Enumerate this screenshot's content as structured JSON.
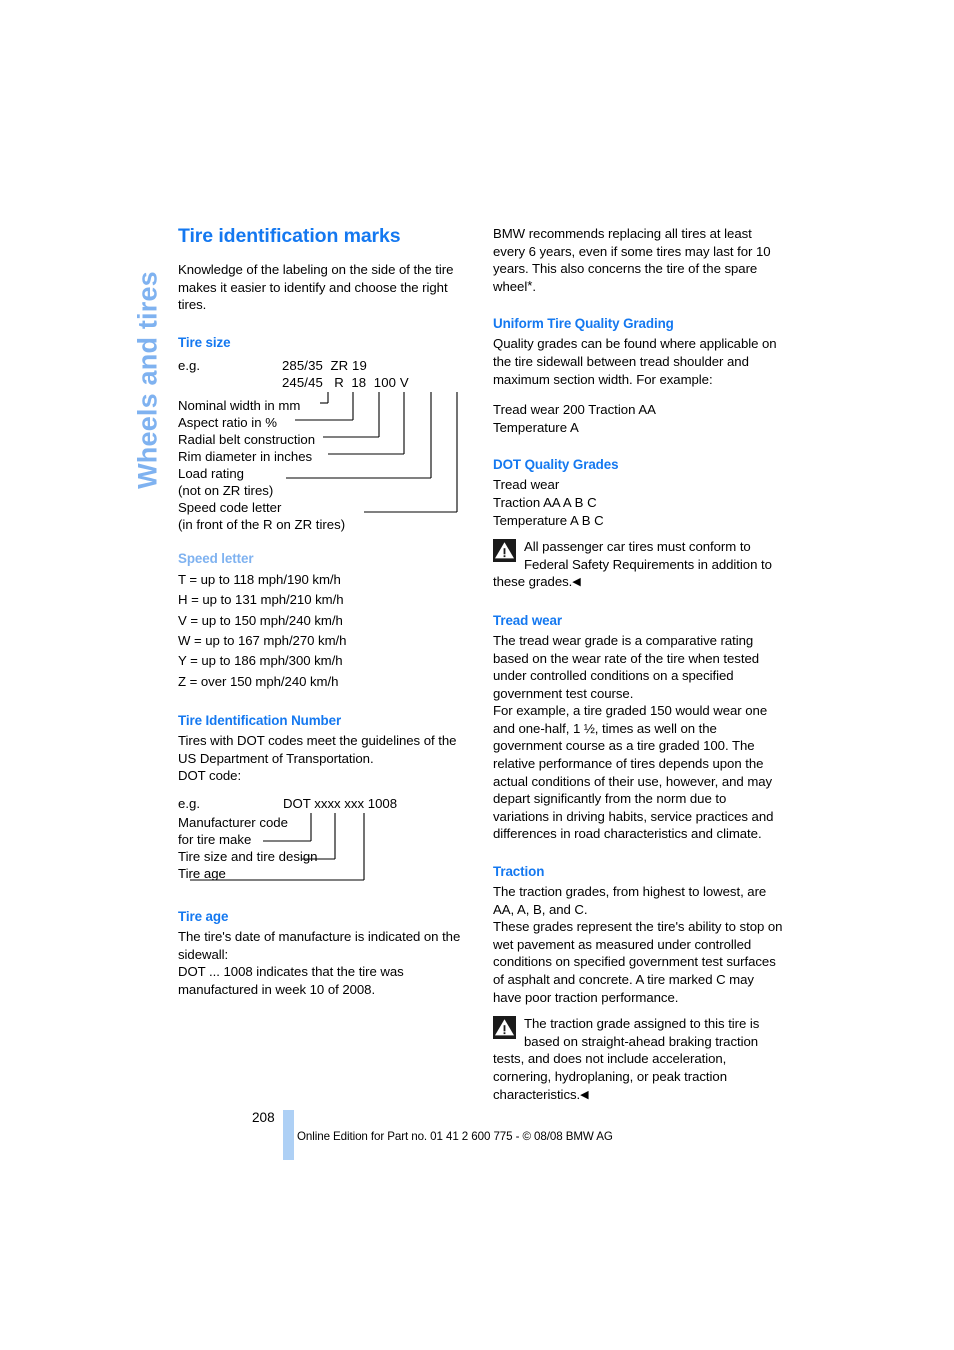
{
  "chapter": {
    "tab_label": "Wheels and tires"
  },
  "left_column": {
    "title": "Tire identification marks",
    "intro": "Knowledge of the labeling on the side of the tire makes it easier to identify and choose the right tires.",
    "tire_size": {
      "heading": "Tire size",
      "eg_label": "e.g.",
      "code_line_1": "285/35  ZR 19",
      "code_line_2": "245/45   R  18  100 V",
      "labels": [
        "Nominal width in mm",
        "Aspect ratio in %",
        "Radial belt construction",
        "Rim diameter in inches",
        "Load rating",
        "(not on ZR tires)",
        "Speed code letter",
        "(in front of the R on ZR tires)"
      ]
    },
    "speed_letter": {
      "heading": "Speed letter",
      "entries": [
        "T = up to 118 mph/190 km/h",
        "H = up to 131 mph/210 km/h",
        "V = up to 150 mph/240 km/h",
        "W = up to 167 mph/270 km/h",
        "Y = up to 186 mph/300 km/h",
        "Z = over 150 mph/240 km/h"
      ]
    },
    "tin": {
      "heading": "Tire Identification Number",
      "paragraph": "Tires with DOT codes meet the guidelines of the US Department of Transportation.",
      "dot_code_label": "DOT code:",
      "eg_label": "e.g.",
      "code_line": "DOT xxxx xxx 1008",
      "labels": [
        "Manufacturer code",
        "for tire make",
        "Tire size and tire design",
        "Tire age"
      ]
    },
    "tire_age": {
      "heading": "Tire age",
      "paragraph_1": "The tire's date of manufacture is indicated on the sidewall:",
      "paragraph_2": "DOT ... 1008 indicates that the tire was manufactured in week 10 of 2008."
    }
  },
  "right_column": {
    "intro": "BMW recommends replacing all tires at least every 6 years, even if some tires may last for 10 years. This also concerns the tire of the spare wheel",
    "intro_asterisk": "*",
    "intro_end": ".",
    "uniform_grading": {
      "heading": "Uniform Tire Quality Grading",
      "paragraph": "Quality grades can be found where applicable on the tire sidewall between tread shoulder and maximum section width. For example:",
      "example_line_1": "Tread wear 200 Traction AA",
      "example_line_2": "Temperature A"
    },
    "dot_quality_grades": {
      "heading": "DOT Quality Grades",
      "lines": [
        "Tread wear",
        "Traction AA A B C",
        "Temperature A B C"
      ],
      "note": "All passenger car tires must conform to Federal Safety Requirements in addition to these grades.",
      "note_arrow": "◀"
    },
    "tread_wear": {
      "heading": "Tread wear",
      "paragraph_1": "The tread wear grade is a comparative rating based on the wear rate of the tire when tested under controlled conditions on a specified government test course.",
      "paragraph_2": "For example, a tire graded 150 would wear one and one-half, 1 ½, times as well on the government course as a tire graded 100. The relative performance of tires depends upon the actual conditions of their use, however, and may depart significantly from the norm due to variations in driving habits, service practices and differences in road characteristics and climate."
    },
    "traction": {
      "heading": "Traction",
      "paragraph_1": "The traction grades, from highest to lowest, are AA, A, B, and C.",
      "paragraph_2": "These grades represent the tire's ability to stop on wet pavement as measured under controlled conditions on specified government test surfaces of asphalt and concrete. A tire marked C may have poor traction performance.",
      "note": "The traction grade assigned to this tire is based on straight-ahead braking traction tests, and does not include acceleration, cornering, hydroplaning, or peak traction characteristics.",
      "note_arrow": "◀"
    }
  },
  "footer": {
    "page_number": "208",
    "text": "Online Edition for Part no. 01 41 2 600 775 - © 08/08 BMW AG"
  },
  "colors": {
    "heading_blue": "#1478F0",
    "light_blue": "#7FB2F0",
    "footer_bar_blue": "#AED0F5",
    "warning_icon_bg": "#1a1a1a"
  },
  "icons": {
    "warning": "warning-triangle-icon",
    "note_end": "note-end-arrow-icon"
  }
}
